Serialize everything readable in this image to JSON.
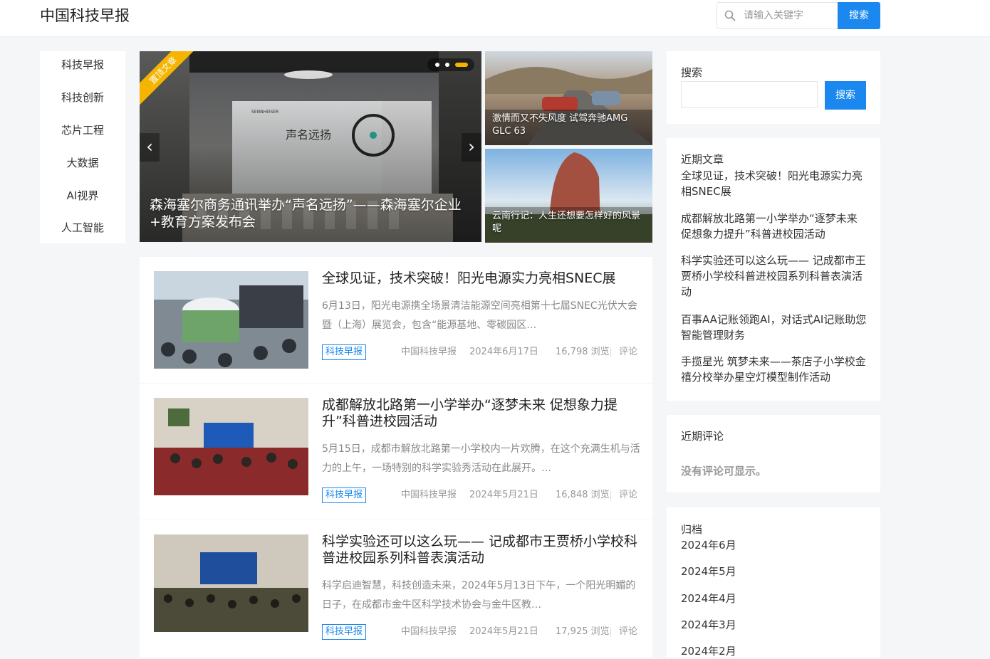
{
  "header": {
    "site_title": "中国科技早报",
    "search_placeholder": "请输入关键字",
    "search_button": "搜索"
  },
  "nav": [
    "科技早报",
    "科技创新",
    "芯片工程",
    "大数据",
    "AI视界",
    "人工智能"
  ],
  "slider": {
    "ribbon": "置顶文章",
    "caption": "森海塞尔商务通讯举办“声名远扬”——森海塞尔企业+教育方案发布会",
    "image_text": "声名远扬",
    "image_logo": "SENNHEISER",
    "prev_icon": "chevron-left-icon",
    "next_icon": "chevron-right-icon",
    "slide_count": 3,
    "active_slide": 3
  },
  "side_cards": [
    {
      "caption": "激情而又不失风度 试驾奔驰AMG GLC 63"
    },
    {
      "caption": "云南行记：人生还想要怎样好的风景呢"
    }
  ],
  "posts": [
    {
      "title": "全球见证，技术突破！阳光电源实力亮相SNEC展",
      "excerpt": "6月13日，阳光电源携全场景清洁能源空间亮相第十七届SNEC光伏大会暨（上海）展览会，包含“能源基地、零碳园区…",
      "category": "科技早报",
      "author": "中国科技早报",
      "date": "2024年6月17日",
      "views": "16,798 浏览",
      "comments": "评论"
    },
    {
      "title": "成都解放北路第一小学举办“逐梦未来 促想象力提升”科普进校园活动",
      "excerpt": "5月15日，成都市解放北路第一小学校内一片欢腾，在这个充满生机与活力的上午，一场特别的科学实验秀活动在此展开。…",
      "category": "科技早报",
      "author": "中国科技早报",
      "date": "2024年5月21日",
      "views": "16,848 浏览",
      "comments": "评论"
    },
    {
      "title": "科学实验还可以这么玩—— 记成都市王贾桥小学校科普进校园系列科普表演活动",
      "excerpt": "科学启迪智慧，科技创造未来，2024年5月13日下午，一个阳光明媚的日子，在成都市金牛区科学技术协会与金牛区教…",
      "category": "科技早报",
      "author": "中国科技早报",
      "date": "2024年5月21日",
      "views": "17,925 浏览",
      "comments": "评论"
    }
  ],
  "sidebar": {
    "search_title": "搜索",
    "search_button": "搜索",
    "recent_title": "近期文章",
    "recent": [
      "全球见证，技术突破！阳光电源实力亮相SNEC展",
      "成都解放北路第一小学举办“逐梦未来 促想象力提升”科普进校园活动",
      "科学实验还可以这么玩—— 记成都市王贾桥小学校科普进校园系列科普表演活动",
      "百事AA记账领跑AI，对话式AI记账助您智能管理财务",
      "手揽星光 筑梦未来——茶店子小学校金禧分校举办星空灯模型制作活动"
    ],
    "comments_title": "近期评论",
    "no_comments": "没有评论可显示。",
    "archive_title": "归档",
    "archives": [
      "2024年6月",
      "2024年5月",
      "2024年4月",
      "2024年3月",
      "2024年2月"
    ]
  }
}
